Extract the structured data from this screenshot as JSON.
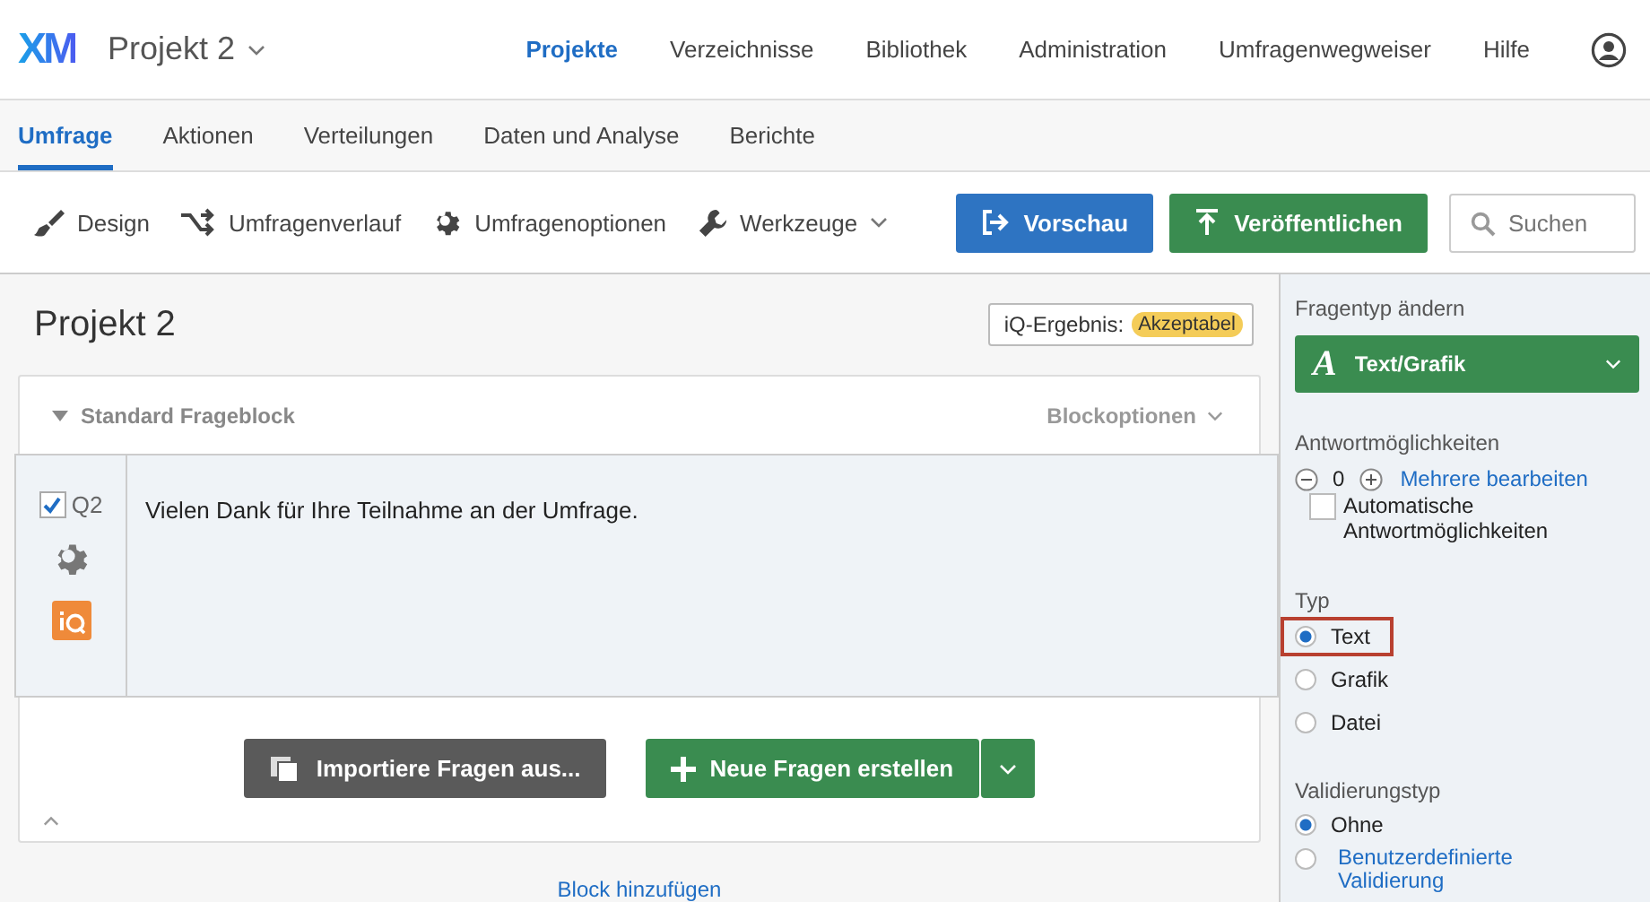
{
  "header": {
    "logo": "XM",
    "project": "Projekt 2",
    "nav": [
      {
        "label": "Projekte",
        "selected": true
      },
      {
        "label": "Verzeichnisse",
        "selected": false
      },
      {
        "label": "Bibliothek",
        "selected": false
      },
      {
        "label": "Administration",
        "selected": false
      },
      {
        "label": "Umfragenwegweiser",
        "selected": false
      },
      {
        "label": "Hilfe",
        "selected": false
      }
    ]
  },
  "tabs": [
    {
      "label": "Umfrage",
      "selected": true
    },
    {
      "label": "Aktionen",
      "selected": false
    },
    {
      "label": "Verteilungen",
      "selected": false
    },
    {
      "label": "Daten und Analyse",
      "selected": false
    },
    {
      "label": "Berichte",
      "selected": false
    }
  ],
  "toolbar": {
    "items": [
      {
        "kind": "brush",
        "label": "Design"
      },
      {
        "kind": "flow",
        "label": "Umfragenverlauf"
      },
      {
        "kind": "gear",
        "label": "Umfragenoptionen"
      },
      {
        "kind": "wrench",
        "label": "Werkzeuge"
      }
    ],
    "preview": "Vorschau",
    "publish": "Veröffentlichen",
    "search": {
      "placeholder": "Suchen"
    }
  },
  "survey": {
    "title": "Projekt 2",
    "iq_label": "iQ-Ergebnis:",
    "iq_badge": "Akzeptabel",
    "block": {
      "name": "Standard Frageblock",
      "options": "Blockoptionen",
      "questions": [
        {
          "id": "Q2",
          "checked": true,
          "text": "Vielen Dank für Ihre Teilnahme an der Umfrage."
        }
      ],
      "import": "Importiere Fragen aus...",
      "new": "Neue Fragen erstellen"
    },
    "add_block": "Block hinzufügen"
  },
  "sidebar": {
    "type_heading": "Fragentyp ändern",
    "type_icon": "A",
    "type_value": "Text/Grafik",
    "choices_heading": "Antwortmöglichkeiten",
    "choices_count": "0",
    "edit_multiple": "Mehrere bearbeiten",
    "auto_choices": {
      "label": "Automatische Antwortmöglichkeiten",
      "checked": false
    },
    "kind_heading": "Typ",
    "kinds": [
      {
        "label": "Text",
        "selected": true,
        "highlighted": true
      },
      {
        "label": "Grafik",
        "selected": false,
        "highlighted": false
      },
      {
        "label": "Datei",
        "selected": false,
        "highlighted": false
      }
    ],
    "validation_heading": "Validierungstyp",
    "validations": [
      {
        "label": "Ohne",
        "selected": true,
        "link": false
      },
      {
        "label": "Benutzerdefinierte Validierung",
        "selected": false,
        "link": true
      }
    ]
  }
}
